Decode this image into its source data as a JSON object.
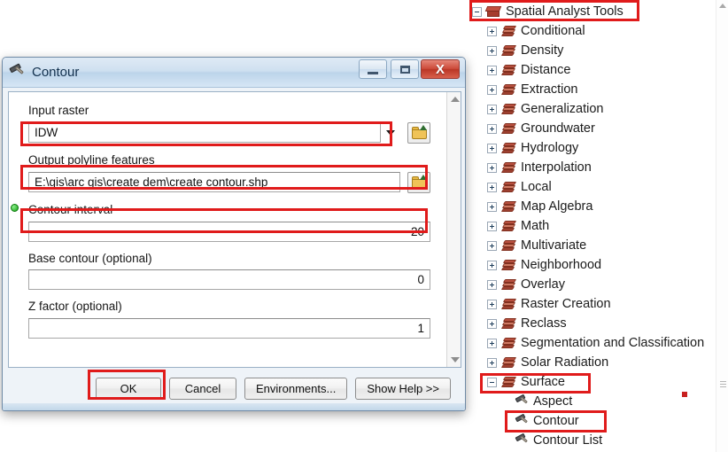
{
  "dialog": {
    "title": "Contour",
    "title_icon": "hammer-icon",
    "window_buttons": {
      "minimize": "–",
      "maximize": "□",
      "close": "X"
    },
    "fields": [
      {
        "label": "Input raster",
        "value": "IDW",
        "control": "combobox",
        "has_browse": true,
        "required_marker": false,
        "highlighted": true,
        "align": "left"
      },
      {
        "label": "Output polyline features",
        "value": "E:\\gis\\arc gis\\create dem\\create contour.shp",
        "control": "textbox",
        "has_browse": true,
        "required_marker": false,
        "highlighted": true,
        "align": "left"
      },
      {
        "label": "Contour interval",
        "value": "20",
        "control": "textbox",
        "has_browse": false,
        "required_marker": true,
        "highlighted": true,
        "align": "right"
      },
      {
        "label": "Base contour (optional)",
        "value": "0",
        "control": "textbox",
        "has_browse": false,
        "required_marker": false,
        "highlighted": false,
        "align": "right"
      },
      {
        "label": "Z factor (optional)",
        "value": "1",
        "control": "textbox",
        "has_browse": false,
        "required_marker": false,
        "highlighted": false,
        "align": "right"
      }
    ],
    "buttons": [
      {
        "label": "OK",
        "highlighted": true
      },
      {
        "label": "Cancel",
        "highlighted": false
      },
      {
        "label": "Environments...",
        "highlighted": false
      },
      {
        "label": "Show Help >>",
        "highlighted": false
      }
    ]
  },
  "toolbox": {
    "root": {
      "label": "Spatial Analyst Tools",
      "icon": "toolbox-icon",
      "expanded": true,
      "highlighted": true
    },
    "toolsets": [
      {
        "label": "Conditional",
        "icon": "toolset-icon",
        "expanded": false,
        "highlighted": false
      },
      {
        "label": "Density",
        "icon": "toolset-icon",
        "expanded": false,
        "highlighted": false
      },
      {
        "label": "Distance",
        "icon": "toolset-icon",
        "expanded": false,
        "highlighted": false
      },
      {
        "label": "Extraction",
        "icon": "toolset-icon",
        "expanded": false,
        "highlighted": false
      },
      {
        "label": "Generalization",
        "icon": "toolset-icon",
        "expanded": false,
        "highlighted": false
      },
      {
        "label": "Groundwater",
        "icon": "toolset-icon",
        "expanded": false,
        "highlighted": false
      },
      {
        "label": "Hydrology",
        "icon": "toolset-icon",
        "expanded": false,
        "highlighted": false
      },
      {
        "label": "Interpolation",
        "icon": "toolset-icon",
        "expanded": false,
        "highlighted": false
      },
      {
        "label": "Local",
        "icon": "toolset-icon",
        "expanded": false,
        "highlighted": false
      },
      {
        "label": "Map Algebra",
        "icon": "toolset-icon",
        "expanded": false,
        "highlighted": false
      },
      {
        "label": "Math",
        "icon": "toolset-icon",
        "expanded": false,
        "highlighted": false
      },
      {
        "label": "Multivariate",
        "icon": "toolset-icon",
        "expanded": false,
        "highlighted": false
      },
      {
        "label": "Neighborhood",
        "icon": "toolset-icon",
        "expanded": false,
        "highlighted": false
      },
      {
        "label": "Overlay",
        "icon": "toolset-icon",
        "expanded": false,
        "highlighted": false
      },
      {
        "label": "Raster Creation",
        "icon": "toolset-icon",
        "expanded": false,
        "highlighted": false
      },
      {
        "label": "Reclass",
        "icon": "toolset-icon",
        "expanded": false,
        "highlighted": false
      },
      {
        "label": "Segmentation and Classification",
        "icon": "toolset-icon",
        "expanded": false,
        "highlighted": false
      },
      {
        "label": "Solar Radiation",
        "icon": "toolset-icon",
        "expanded": false,
        "highlighted": false
      },
      {
        "label": "Surface",
        "icon": "toolset-icon",
        "expanded": true,
        "highlighted": true
      }
    ],
    "surface_tools": [
      {
        "label": "Aspect",
        "icon": "hammer-icon",
        "highlighted": false
      },
      {
        "label": "Contour",
        "icon": "hammer-icon",
        "highlighted": true
      },
      {
        "label": "Contour List",
        "icon": "hammer-icon",
        "highlighted": false
      }
    ]
  },
  "colors": {
    "annotation": "#e01b1b",
    "required": "#14a014",
    "title_bar": "#cfe0f0",
    "close_button": "#cc4a39"
  }
}
